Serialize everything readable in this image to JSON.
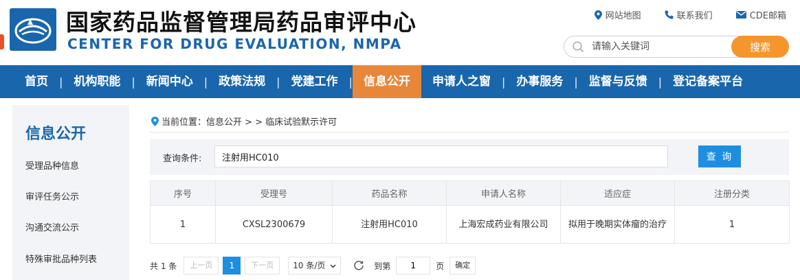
{
  "header": {
    "title_cn": "国家药品监督管理局药品审评中心",
    "title_en": "CENTER FOR DRUG EVALUATION, NMPA",
    "links": [
      {
        "label": "网站地图",
        "icon": "location-pin-icon"
      },
      {
        "label": "联系我们",
        "icon": "phone-icon"
      },
      {
        "label": "CDE邮箱",
        "icon": "mail-icon"
      }
    ],
    "search": {
      "placeholder": "请输入关键词",
      "button": "搜索"
    },
    "accent_color": "#1a66ad",
    "orange_color": "#f5962d"
  },
  "nav": {
    "items": [
      "首页",
      "机构职能",
      "新闻中心",
      "政策法规",
      "党建工作",
      "信息公开",
      "申请人之窗",
      "办事服务",
      "监督与反馈",
      "登记备案平台"
    ],
    "active_index": 5
  },
  "sidebar": {
    "title": "信息公开",
    "items": [
      "受理品种信息",
      "审评任务公示",
      "沟通交流公示",
      "特殊审批品种列表"
    ]
  },
  "breadcrumb": {
    "text": "当前位置：信息公开 > > 临床试验默示许可"
  },
  "query": {
    "label": "查询条件:",
    "value": "注射用HC010",
    "button": "查 询"
  },
  "table": {
    "headers": [
      "序号",
      "受理号",
      "药品名称",
      "申请人名称",
      "适应症",
      "注册分类"
    ],
    "rows": [
      [
        "1",
        "CXSL2300679",
        "注射用HC010",
        "上海宏成药业有限公司",
        "拟用于晚期实体瘤的治疗",
        "1"
      ]
    ]
  },
  "pager": {
    "total": "共 1 条",
    "prev": "上一页",
    "current": "1",
    "next": "下一页",
    "page_size": "10 条/页",
    "goto_label": "到第",
    "goto_value": "1",
    "page_unit": "页",
    "confirm": "确定"
  }
}
